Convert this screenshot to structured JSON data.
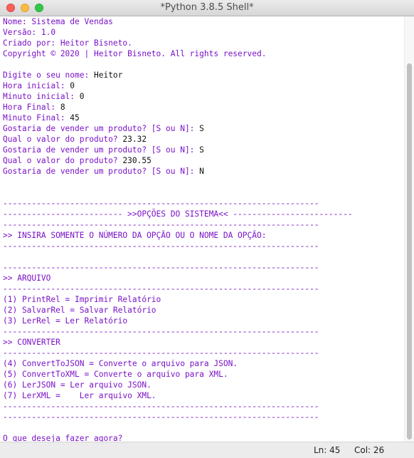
{
  "window": {
    "title": "*Python 3.8.5 Shell*"
  },
  "colors": {
    "output": "#7a12c8",
    "builtin_output": "#1d12d1",
    "input": "#111111",
    "background": "#ffffff"
  },
  "lines": [
    {
      "text": "Nome: Sistema de Vendas",
      "style": "purple"
    },
    {
      "text": "Versão: 1.0",
      "style": "purple"
    },
    {
      "text": "Criado por: Heitor Bisneto.",
      "style": "purple"
    },
    {
      "text": "Copyright © 2020 | Heitor Bisneto. All rights reserved.",
      "style": "purple"
    },
    {
      "text": "",
      "style": "purple"
    },
    {
      "prompt": "Digite o seu nome: ",
      "input": "Heitor"
    },
    {
      "prompt": "Hora inicial: ",
      "input": "0"
    },
    {
      "prompt": "Minuto inicial: ",
      "input": "0"
    },
    {
      "prompt": "Hora Final: ",
      "input": "8"
    },
    {
      "prompt": "Minuto Final: ",
      "input": "45"
    },
    {
      "prompt": "Gostaria de vender um produto? [S ou N]: ",
      "input": "S"
    },
    {
      "prompt": "Qual o valor do produto? ",
      "input": "23.32"
    },
    {
      "prompt": "Gostaria de vender um produto? [S ou N]: ",
      "input": "S"
    },
    {
      "prompt": "Qual o valor do produto? ",
      "input": "230.55"
    },
    {
      "prompt": "Gostaria de vender um produto? [S ou N]: ",
      "input": "N"
    },
    {
      "text": "",
      "style": "purple"
    },
    {
      "text": "",
      "style": "purple"
    },
    {
      "text": "------------------------------------------------------------------",
      "style": "purple"
    },
    {
      "text": "------------------------- >>OPÇÕES DO SISTEMA<< -------------------------",
      "style": "purple"
    },
    {
      "text": "------------------------------------------------------------------",
      "style": "purple"
    },
    {
      "text": ">> INSIRA SOMENTE O NÚMERO DA OPÇÃO OU O NOME DA OPÇÃO:",
      "style": "purple"
    },
    {
      "text": "------------------------------------------------------------------",
      "style": "purple"
    },
    {
      "text": "",
      "style": "purple"
    },
    {
      "text": "------------------------------------------------------------------",
      "style": "purple"
    },
    {
      "text": ">> ARQUIVO",
      "style": "purple"
    },
    {
      "text": "------------------------------------------------------------------",
      "style": "purple"
    },
    {
      "text": "(1) PrintRel = Imprimir Relatório",
      "style": "purple"
    },
    {
      "text": "(2) SalvarRel = Salvar Relatório",
      "style": "purple"
    },
    {
      "text": "(3) LerRel = Ler Relatório",
      "style": "purple"
    },
    {
      "text": "------------------------------------------------------------------",
      "style": "purple"
    },
    {
      "text": ">> CONVERTER",
      "style": "purple"
    },
    {
      "text": "------------------------------------------------------------------",
      "style": "purple"
    },
    {
      "text": "(4) ConvertToJSON = Converte o arquivo para JSON.",
      "style": "purple"
    },
    {
      "text": "(5) ConvertToXML = Converte o arquivo para XML.",
      "style": "purple"
    },
    {
      "text": "(6) LerJSON = Ler arquivo JSON.",
      "style": "purple"
    },
    {
      "text": "(7) LerXML =    Ler arquivo XML.",
      "style": "purple"
    },
    {
      "text": "------------------------------------------------------------------",
      "style": "purple"
    },
    {
      "text": "------------------------------------------------------------------",
      "style": "purple"
    },
    {
      "text": "",
      "style": "purple"
    },
    {
      "text": "O que deseja fazer agora?",
      "style": "purple"
    }
  ],
  "status": {
    "ln": "Ln: 45",
    "col": "Col: 26"
  }
}
